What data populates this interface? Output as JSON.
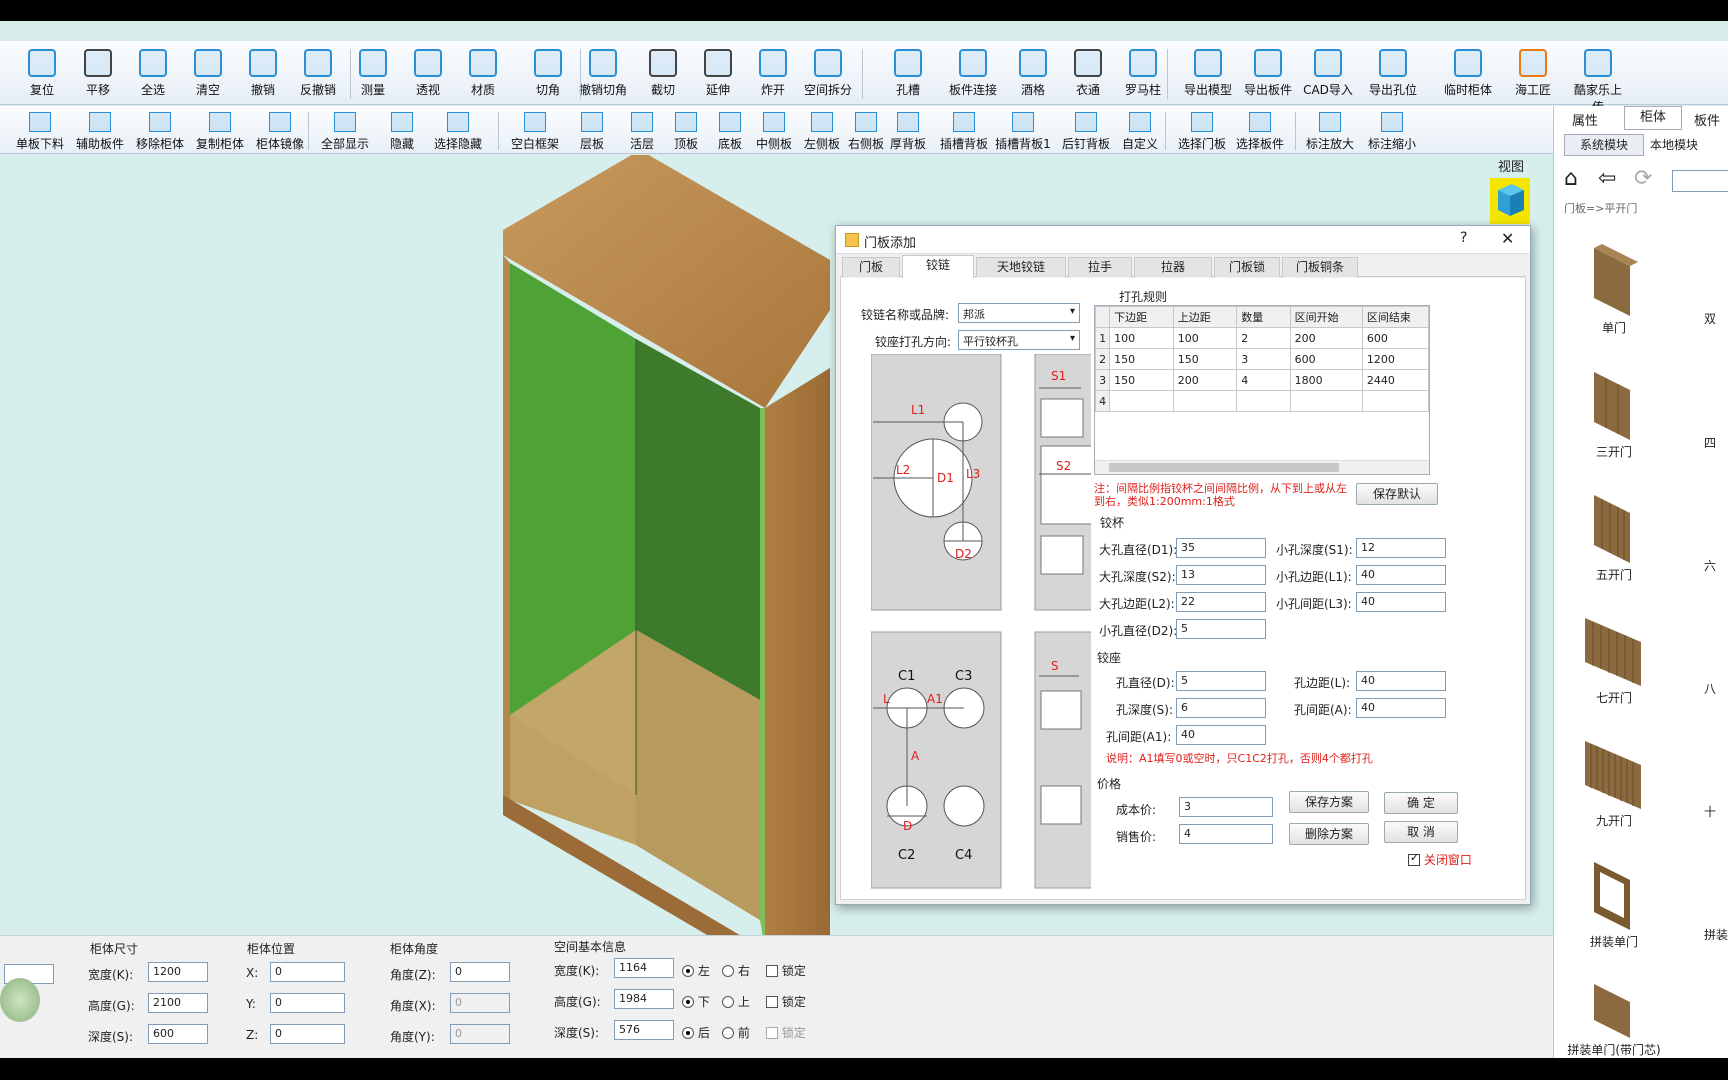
{
  "toolbar1": {
    "items": [
      "复位",
      "平移",
      "全选",
      "清空",
      "撤销",
      "反撤销",
      "测量",
      "透视",
      "材质",
      "切角",
      "撤销切角",
      "截切",
      "延伸",
      "炸开",
      "空间拆分",
      "孔槽",
      "板件连接",
      "酒格",
      "衣通",
      "罗马柱",
      "导出模型",
      "导出板件",
      "CAD导入",
      "导出孔位",
      "临时柜体",
      "海工匠",
      "酷家乐上传"
    ]
  },
  "toolbar2": {
    "items": [
      "单板下料",
      "辅助板件",
      "移除柜体",
      "复制柜体",
      "柜体镜像",
      "全部显示",
      "隐藏",
      "选择隐藏",
      "空白框架",
      "层板",
      "活层",
      "顶板",
      "底板",
      "中侧板",
      "左侧板",
      "右侧板",
      "厚背板",
      "插槽背板",
      "插槽背板1",
      "后钉背板",
      "自定义",
      "选择门板",
      "选择板件",
      "标注放大",
      "标注缩小"
    ]
  },
  "view": {
    "label": "视图"
  },
  "dialog": {
    "title": "门板添加",
    "help": "?",
    "close": "✕",
    "tabs": [
      "门板",
      "铰链",
      "天地铰链",
      "拉手",
      "拉器",
      "门板锁",
      "门板铜条"
    ],
    "hinge_name_label": "铰链名称或品牌:",
    "hinge_name_value": "邦派",
    "hinge_dir_label": "铰座打孔方向:",
    "hinge_dir_value": "平行铰杯孔",
    "diagram_labels": [
      "L1",
      "L2",
      "D1",
      "L3",
      "D2",
      "S1",
      "S2",
      "C1",
      "C3",
      "L",
      "A1",
      "A",
      "D",
      "C2",
      "C4",
      "S"
    ],
    "rules_title": "打孔规则",
    "rules_columns": [
      "下边距",
      "上边距",
      "数量",
      "区间开始",
      "区间结束"
    ],
    "rules_rows": [
      {
        "n": "1",
        "cells": [
          "100",
          "100",
          "2",
          "200",
          "600"
        ]
      },
      {
        "n": "2",
        "cells": [
          "150",
          "150",
          "3",
          "600",
          "1200"
        ]
      },
      {
        "n": "3",
        "cells": [
          "150",
          "200",
          "4",
          "1800",
          "2440"
        ]
      },
      {
        "n": "4",
        "cells": [
          "",
          "",
          "",
          "",
          ""
        ]
      }
    ],
    "note": "注：间隔比例指铰杯之间间隔比例，从下到上或从左到右，类似1:200mm:1格式",
    "save_default": "保存默认",
    "cup": {
      "title": "铰杯",
      "fields": [
        {
          "label": "大孔直径(D1):",
          "value": "35"
        },
        {
          "label": "小孔深度(S1):",
          "value": "12"
        },
        {
          "label": "大孔深度(S2):",
          "value": "13"
        },
        {
          "label": "小孔边距(L1):",
          "value": "40"
        },
        {
          "label": "大孔边距(L2):",
          "value": "22"
        },
        {
          "label": "小孔间距(L3):",
          "value": "40"
        },
        {
          "label": "小孔直径(D2):",
          "value": "5"
        }
      ]
    },
    "seat": {
      "title": "铰座",
      "fields": [
        {
          "label": "孔直径(D):",
          "value": "5"
        },
        {
          "label": "孔边距(L):",
          "value": "40"
        },
        {
          "label": "孔深度(S):",
          "value": "6"
        },
        {
          "label": "孔间距(A):",
          "value": "40"
        },
        {
          "label": "孔间距(A1):",
          "value": "40"
        }
      ],
      "note": "说明：A1填写0或空时，只C1C2打孔，否则4个都打孔"
    },
    "price": {
      "title": "价格",
      "cost_label": "成本价:",
      "cost_value": "3",
      "sale_label": "销售价:",
      "sale_value": "4",
      "save_plan": "保存方案",
      "delete_plan": "删除方案",
      "ok": "确 定",
      "cancel": "取 消",
      "close_window": "关闭窗口"
    }
  },
  "right_panel": {
    "tabs": [
      "属性",
      "柜体",
      "板件"
    ],
    "subtabs": [
      "系统模块",
      "本地模块"
    ],
    "breadcrumb": "门板=>平开门",
    "items": [
      "单门",
      "三开门",
      "五开门",
      "七开门",
      "九开门",
      "拼装单门",
      "拼装单门(带门芯)"
    ],
    "items_right": [
      "双",
      "四",
      "六",
      "八",
      "十",
      "拼装"
    ]
  },
  "bottom": {
    "size_title": "柜体尺寸",
    "width_label": "宽度(K):",
    "width": "1200",
    "height_label": "高度(G):",
    "height": "2100",
    "depth_label": "深度(S):",
    "depth": "600",
    "pos_title": "柜体位置",
    "x_label": "X:",
    "x": "0",
    "y_label": "Y:",
    "y": "0",
    "z_label": "Z:",
    "z": "0",
    "angle_title": "柜体角度",
    "az_label": "角度(Z):",
    "az": "0",
    "ax_label": "角度(X):",
    "ax": "0",
    "ay_label": "角度(Y):",
    "ay": "0",
    "space_title": "空间基本信息",
    "sw_label": "宽度(K):",
    "sw": "1164",
    "sh_label": "高度(G):",
    "sh": "1984",
    "sd_label": "深度(S):",
    "sd": "576",
    "left": "左",
    "right": "右",
    "down": "下",
    "up": "上",
    "back": "后",
    "front": "前",
    "lock": "锁定"
  }
}
